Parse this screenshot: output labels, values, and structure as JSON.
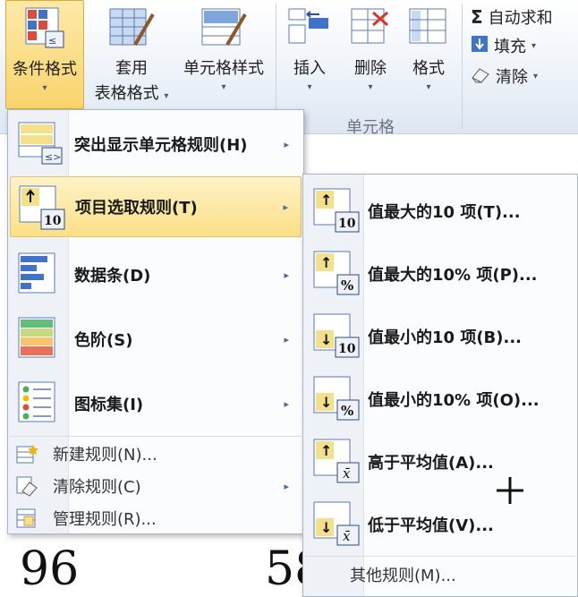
{
  "ribbon": {
    "conditional_format": "条件格式",
    "table_format_line1": "套用",
    "table_format_line2": "表格格式",
    "cell_styles": "单元格样式",
    "insert": "插入",
    "delete": "删除",
    "format": "格式",
    "cells_group": "单元格",
    "autosum": "自动求和",
    "fill": "填充",
    "clear": "清除",
    "sigma": "Σ",
    "dropdown_arrow": "▾"
  },
  "menu": {
    "items": [
      {
        "label": "突出显示单元格规则(H)",
        "icon": "highlight-rules-icon"
      },
      {
        "label": "项目选取规则(T)",
        "icon": "top-bottom-rules-icon"
      },
      {
        "label": "数据条(D)",
        "icon": "data-bars-icon"
      },
      {
        "label": "色阶(S)",
        "icon": "color-scales-icon"
      },
      {
        "label": "图标集(I)",
        "icon": "icon-sets-icon"
      }
    ],
    "small_items": [
      {
        "label": "新建规则(N)...",
        "icon": "new-rule-icon"
      },
      {
        "label": "清除规则(C)",
        "icon": "clear-rules-icon"
      },
      {
        "label": "管理规则(R)...",
        "icon": "manage-rules-icon"
      }
    ],
    "submenu_arrow": "▸"
  },
  "submenu": {
    "items": [
      {
        "label": "值最大的10 项(T)...",
        "badge": "10",
        "arrow": "↑"
      },
      {
        "label": "值最大的10% 项(P)...",
        "badge": "%",
        "arrow": "↑"
      },
      {
        "label": "值最小的10 项(B)...",
        "badge": "10",
        "arrow": "↓"
      },
      {
        "label": "值最小的10% 项(O)...",
        "badge": "%",
        "arrow": "↓"
      },
      {
        "label": "高于平均值(A)...",
        "badge": "x̄",
        "arrow": "↑"
      },
      {
        "label": "低于平均值(V)...",
        "badge": "x̄",
        "arrow": "↓"
      }
    ],
    "more": "其他规则(M)..."
  },
  "sheet": {
    "cell_a": "96",
    "cell_b": "58"
  },
  "colors": {
    "highlight": "#fbdf86",
    "menu_bg": "#fbfcfe",
    "accent_blue": "#2f6fc4"
  }
}
